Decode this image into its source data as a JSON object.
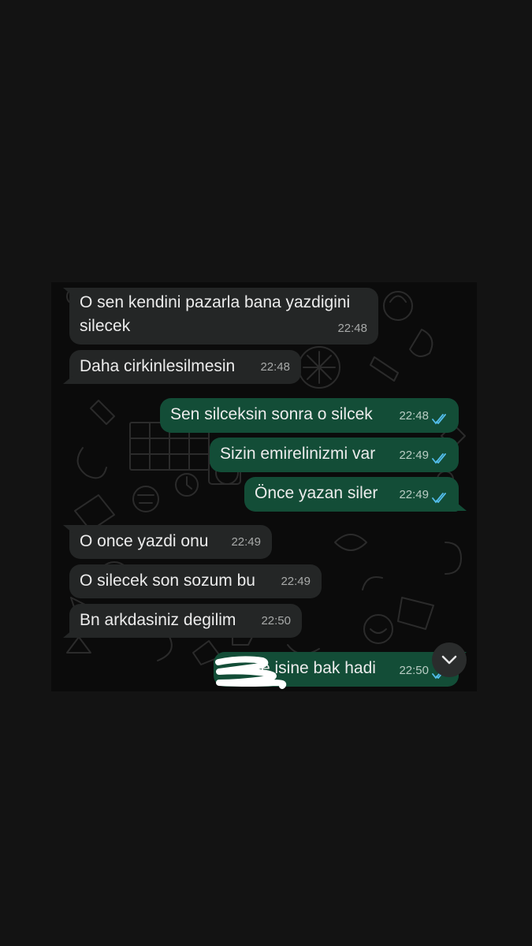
{
  "messages": [
    {
      "direction": "incoming",
      "text_line1": "O sen kendini pazarla bana yazdigini",
      "text_line2": "silecek",
      "time": "22:48"
    },
    {
      "direction": "incoming",
      "text": "Daha cirkinlesilmesin",
      "time": "22:48"
    },
    {
      "direction": "outgoing",
      "text": "Sen silceksin sonra o silcek",
      "time": "22:48",
      "status": "read"
    },
    {
      "direction": "outgoing",
      "text": "Sizin emirelinizmi var",
      "time": "22:49",
      "status": "read"
    },
    {
      "direction": "outgoing",
      "text": "Önce yazan siler",
      "time": "22:49",
      "status": "read"
    },
    {
      "direction": "incoming",
      "text": "O once yazdi onu",
      "time": "22:49"
    },
    {
      "direction": "incoming",
      "text": "O silecek son sozum bu",
      "time": "22:49"
    },
    {
      "direction": "incoming",
      "text": "Bn arkdasiniz degilim",
      "time": "22:50"
    },
    {
      "direction": "outgoing",
      "text": "e isine bak hadi",
      "time": "22:50",
      "status": "read",
      "partially_redacted": true
    }
  ],
  "icons": {
    "read_ticks": "double-check-icon",
    "scroll_down": "chevron-down-icon"
  },
  "colors": {
    "incoming_bubble": "#242626",
    "outgoing_bubble": "#134d37",
    "read_tick": "#53bdeb",
    "background": "#131313"
  }
}
